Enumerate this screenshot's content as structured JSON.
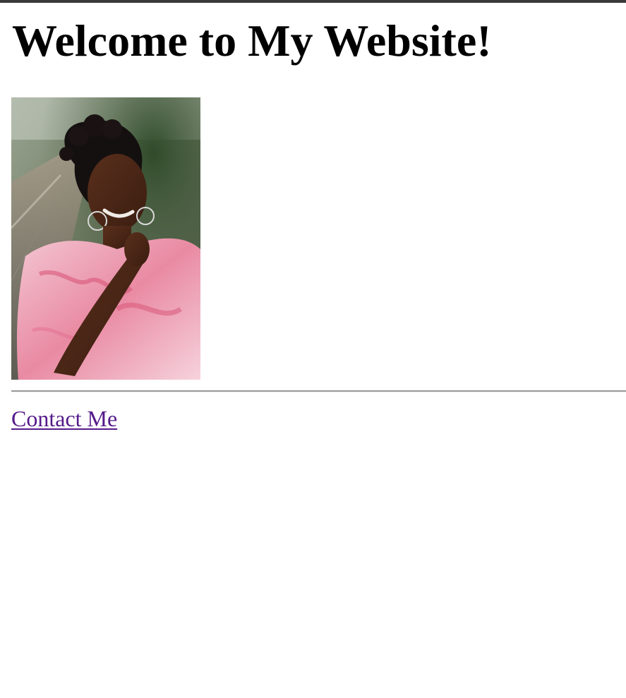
{
  "page": {
    "title": "Welcome to My Website!"
  },
  "photo": {
    "alt": "Portrait of a smiling woman wearing a pink floral blouse and hoop earrings"
  },
  "links": {
    "contact_label": "Contact Me"
  },
  "colors": {
    "link_visited": "#551a8b",
    "divider": "#9a9a9a",
    "top_strip": "#3a3a3a"
  }
}
